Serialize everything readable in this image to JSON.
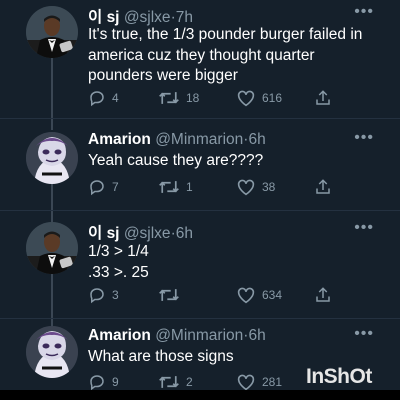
{
  "tweets": [
    {
      "name": "이 sj",
      "handle": "@sjlxe",
      "dot": "·",
      "time": "7h",
      "lines": [
        "It's true, the 1/3 pounder burger failed in",
        "america cuz they thought quarter",
        "pounders were bigger"
      ],
      "replies": "4",
      "retweets": "18",
      "likes": "616",
      "avatar": "tuxedo-man"
    },
    {
      "name": "Amarion",
      "handle": "@Minmarion",
      "dot": "·",
      "time": "6h",
      "lines": [
        "Yeah cause they are????"
      ],
      "replies": "7",
      "retweets": "1",
      "likes": "38",
      "avatar": "cartoon-character"
    },
    {
      "name": "이 sj",
      "handle": "@sjlxe",
      "dot": "·",
      "time": "6h",
      "lines": [
        "1/3 > 1/4",
        ".33 >. 25"
      ],
      "replies": "3",
      "retweets": "",
      "likes": "634",
      "avatar": "tuxedo-man"
    },
    {
      "name": "Amarion",
      "handle": "@Minmarion",
      "dot": "·",
      "time": "6h",
      "lines": [
        "What are those signs"
      ],
      "replies": "9",
      "retweets": "2",
      "likes": "281",
      "avatar": "cartoon-character"
    }
  ],
  "more_label": "•••",
  "watermark": "InShOt",
  "colors": {
    "background": "#15202b",
    "text": "#ffffff",
    "muted": "#8899a6",
    "thread_line": "#3b4754"
  }
}
